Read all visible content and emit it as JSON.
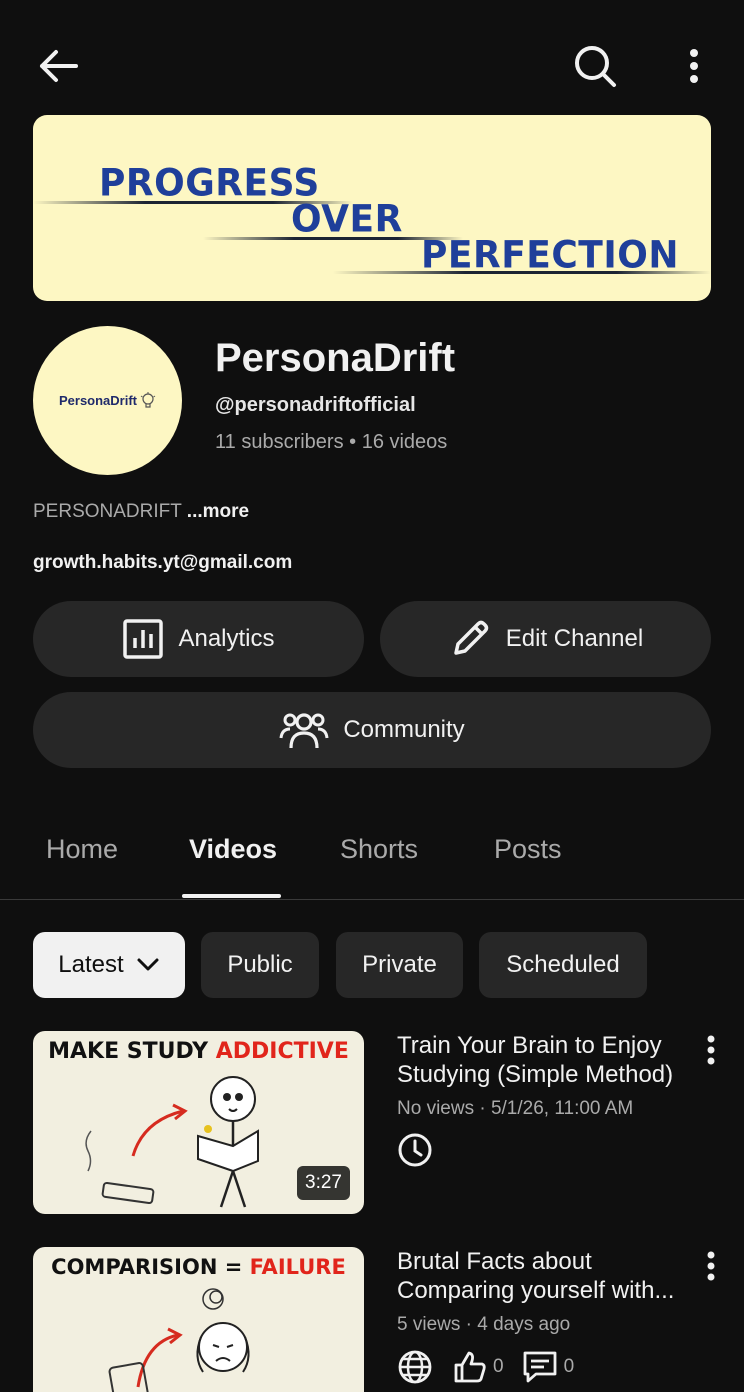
{
  "channel": {
    "banner_lines": [
      "PROGRESS",
      "OVER",
      "PERFECTION"
    ],
    "avatar_text": "PersonaDrift",
    "name": "PersonaDrift",
    "handle": "@personadriftofficial",
    "stats": "11 subscribers • 16 videos",
    "description": "PERSONADRIFT",
    "more_label": "...more",
    "email": "growth.habits.yt@gmail.com"
  },
  "actions": {
    "analytics_label": "Analytics",
    "edit_label": "Edit Channel",
    "community_label": "Community"
  },
  "tabs": [
    {
      "label": "Home",
      "active": false
    },
    {
      "label": "Videos",
      "active": true
    },
    {
      "label": "Shorts",
      "active": false
    },
    {
      "label": "Posts",
      "active": false
    }
  ],
  "filters": [
    {
      "label": "Latest",
      "selected": true,
      "icon": "chevron-down-icon"
    },
    {
      "label": "Public",
      "selected": false
    },
    {
      "label": "Private",
      "selected": false
    },
    {
      "label": "Scheduled",
      "selected": false
    }
  ],
  "videos": [
    {
      "title": "Train Your Brain to Enjoy Studying (Simple Method)",
      "thumb_caption_a": "MAKE STUDY ",
      "thumb_caption_b": "ADDICTIVE",
      "duration": "3:27",
      "meta": "No views · 5/1/26, 11:00 AM",
      "status_icon": "clock-icon"
    },
    {
      "title": "Brutal Facts about Comparing yourself with...",
      "thumb_caption_a": "COMPARISION = ",
      "thumb_caption_b": "FAILURE",
      "meta": "5 views · 4 days ago",
      "likes": "0",
      "comments": "0",
      "status_icon": "globe-icon"
    }
  ],
  "colors": {
    "background": "#0f0f0f",
    "surface": "#272727",
    "text_primary": "#f1f1f1",
    "text_secondary": "#aaaaaa",
    "banner_bg": "#fdf7c3",
    "banner_text": "#1f3f9a",
    "accent_red": "#e1251b"
  }
}
